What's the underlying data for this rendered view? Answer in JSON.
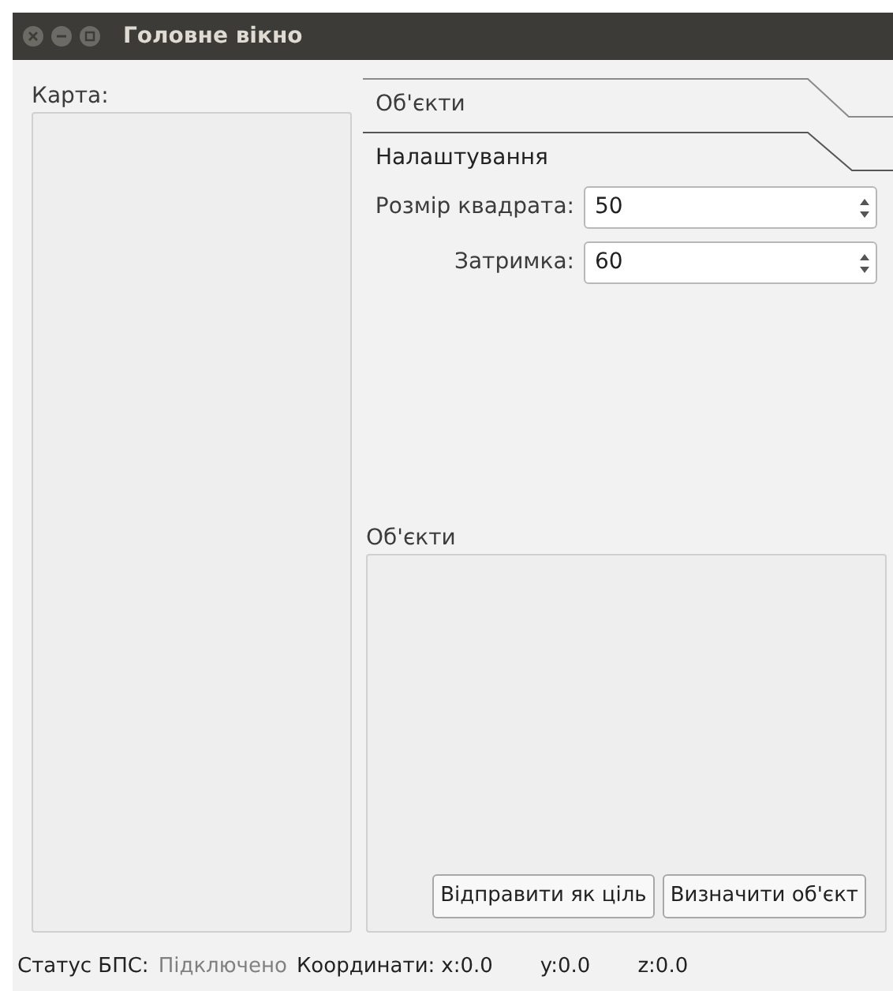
{
  "window": {
    "title": "Головне вікно"
  },
  "map": {
    "label": "Карта:"
  },
  "toolbox": {
    "pages": [
      {
        "label": "Об'єкти",
        "selected": false
      },
      {
        "label": "Налаштування",
        "selected": true
      }
    ]
  },
  "settings": [
    {
      "label": "Розмір квадрата:",
      "value": "50"
    },
    {
      "label": "Затримка:",
      "value": "60"
    }
  ],
  "objects": {
    "label": "Об'єкти",
    "buttons": [
      "Відправити як ціль",
      "Визначити об'єкт"
    ]
  },
  "status_bar": {
    "status_label": "Статус БПС:",
    "status_value": "Підключено",
    "coords_label": "Координати:",
    "x": "x:0.0",
    "y": "y:0.0",
    "z": "z:0.0"
  }
}
